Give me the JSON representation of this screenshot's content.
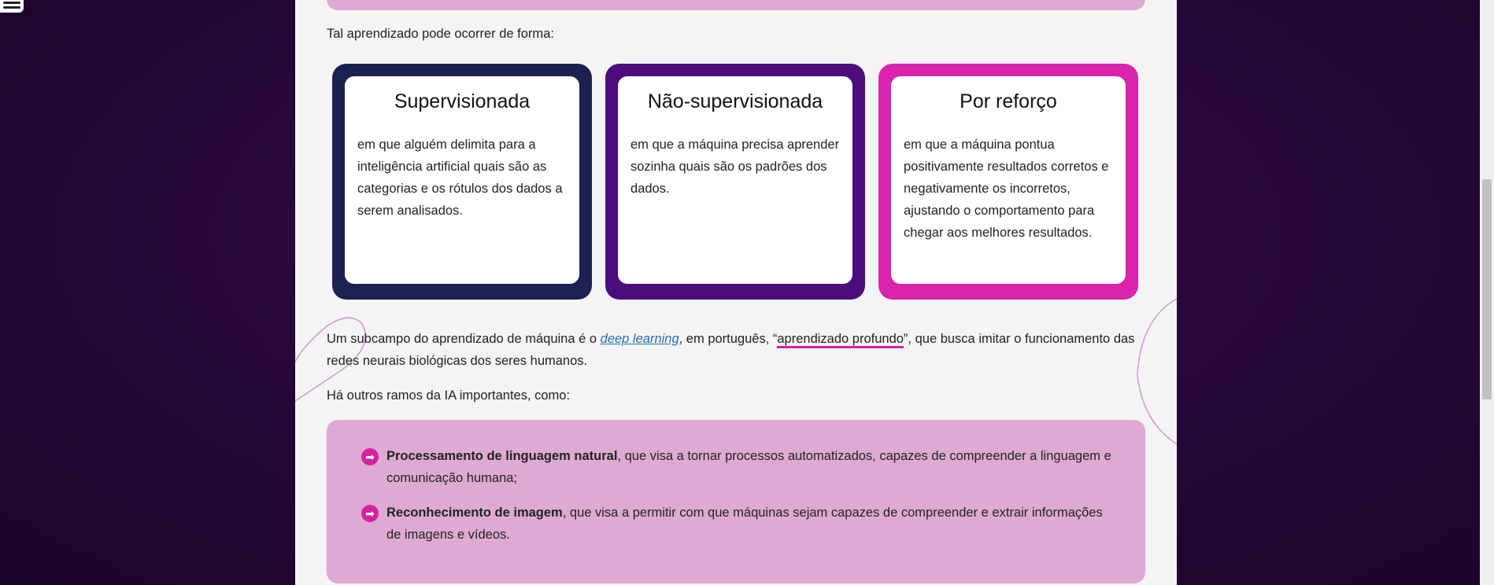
{
  "intro": "Tal aprendizado pode ocorrer de forma:",
  "cards": [
    {
      "title": "Supervisionada",
      "text": "em que alguém delimita para a inteligência artificial quais são as categorias e os rótulos dos dados a serem analisados.",
      "color": "#1b2251"
    },
    {
      "title": "Não-supervisionada",
      "text": "em que a máquina precisa aprender sozinha quais são os padrões dos dados.",
      "color": "#4a0d7a"
    },
    {
      "title": "Por reforço",
      "text": "em que a máquina pontua positivamente resultados corretos e negativamente os incorretos, ajustando o comportamento para chegar aos melhores resultados.",
      "color": "#d924ab"
    }
  ],
  "subfield": {
    "before": "Um subcampo do aprendizado de máquina é o ",
    "link": "deep learning",
    "middle": ", em português, “",
    "highlight": "aprendizado profundo",
    "after": "”, que busca imitar o funcionamento das redes neurais biológicas dos seres humanos."
  },
  "branches_intro": "Há outros ramos da IA importantes, como:",
  "branches": [
    {
      "bold": "Processamento de linguagem natural",
      "text": ", que visa a tornar processos automatizados, capazes de compreender a linguagem e comunicação humana;"
    },
    {
      "bold": "Reconhecimento de imagem",
      "text": ", que visa a permitir com que máquinas sejam capazes de compreender e extrair informações de imagens e vídeos."
    }
  ],
  "icons": {
    "menu": "hamburger-menu-icon",
    "bullet": "arrow-right-circle-icon"
  }
}
